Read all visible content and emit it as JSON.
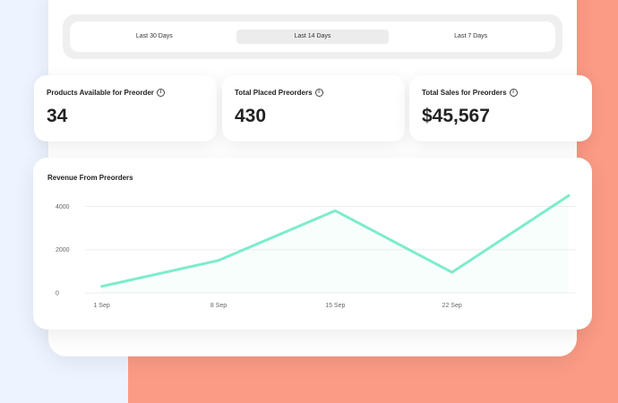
{
  "filters": {
    "tabs": [
      {
        "label": "Last 30 Days"
      },
      {
        "label": "Last 14 Days"
      },
      {
        "label": "Last 7 Days"
      }
    ],
    "active_index": 1
  },
  "stats": [
    {
      "label": "Products Available for Preorder",
      "value": "34"
    },
    {
      "label": "Total Placed Preorders",
      "value": "430"
    },
    {
      "label": "Total Sales for Preorders",
      "value": "$45,567"
    }
  ],
  "chart_data": {
    "type": "line",
    "title": "Revenue From Preorders",
    "x": [
      1,
      8,
      15,
      22,
      29
    ],
    "x_tick_labels": [
      "1 Sep",
      "8 Sep",
      "15 Sep",
      "22 Sep"
    ],
    "x_tick_values": [
      1,
      8,
      15,
      22
    ],
    "y_ticks": [
      0,
      2000,
      4000
    ],
    "ylim": [
      0,
      4600
    ],
    "xlim": [
      0,
      29
    ],
    "series": [
      {
        "values": [
          300,
          1500,
          3800,
          950,
          4500
        ]
      }
    ],
    "grid": true,
    "colors": {
      "line": "#7ceccc",
      "grid": "#eeeeee",
      "tick": "#666666"
    }
  }
}
